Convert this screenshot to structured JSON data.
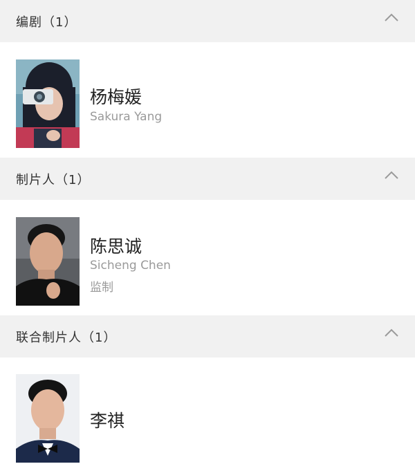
{
  "sections": [
    {
      "title": "编剧（1）",
      "people": [
        {
          "name": "杨梅媛",
          "name_en": "Sakura Yang",
          "role": ""
        }
      ]
    },
    {
      "title": "制片人（1）",
      "people": [
        {
          "name": "陈思诚",
          "name_en": "Sicheng Chen",
          "role": "监制"
        }
      ]
    },
    {
      "title": "联合制片人（1）",
      "people": [
        {
          "name": "李祺",
          "name_en": "",
          "role": ""
        }
      ]
    }
  ],
  "icons": {
    "collapse": "chevron-up-icon"
  },
  "colors": {
    "header_bg": "#f1f1f1",
    "secondary_text": "#9a9a9a"
  }
}
